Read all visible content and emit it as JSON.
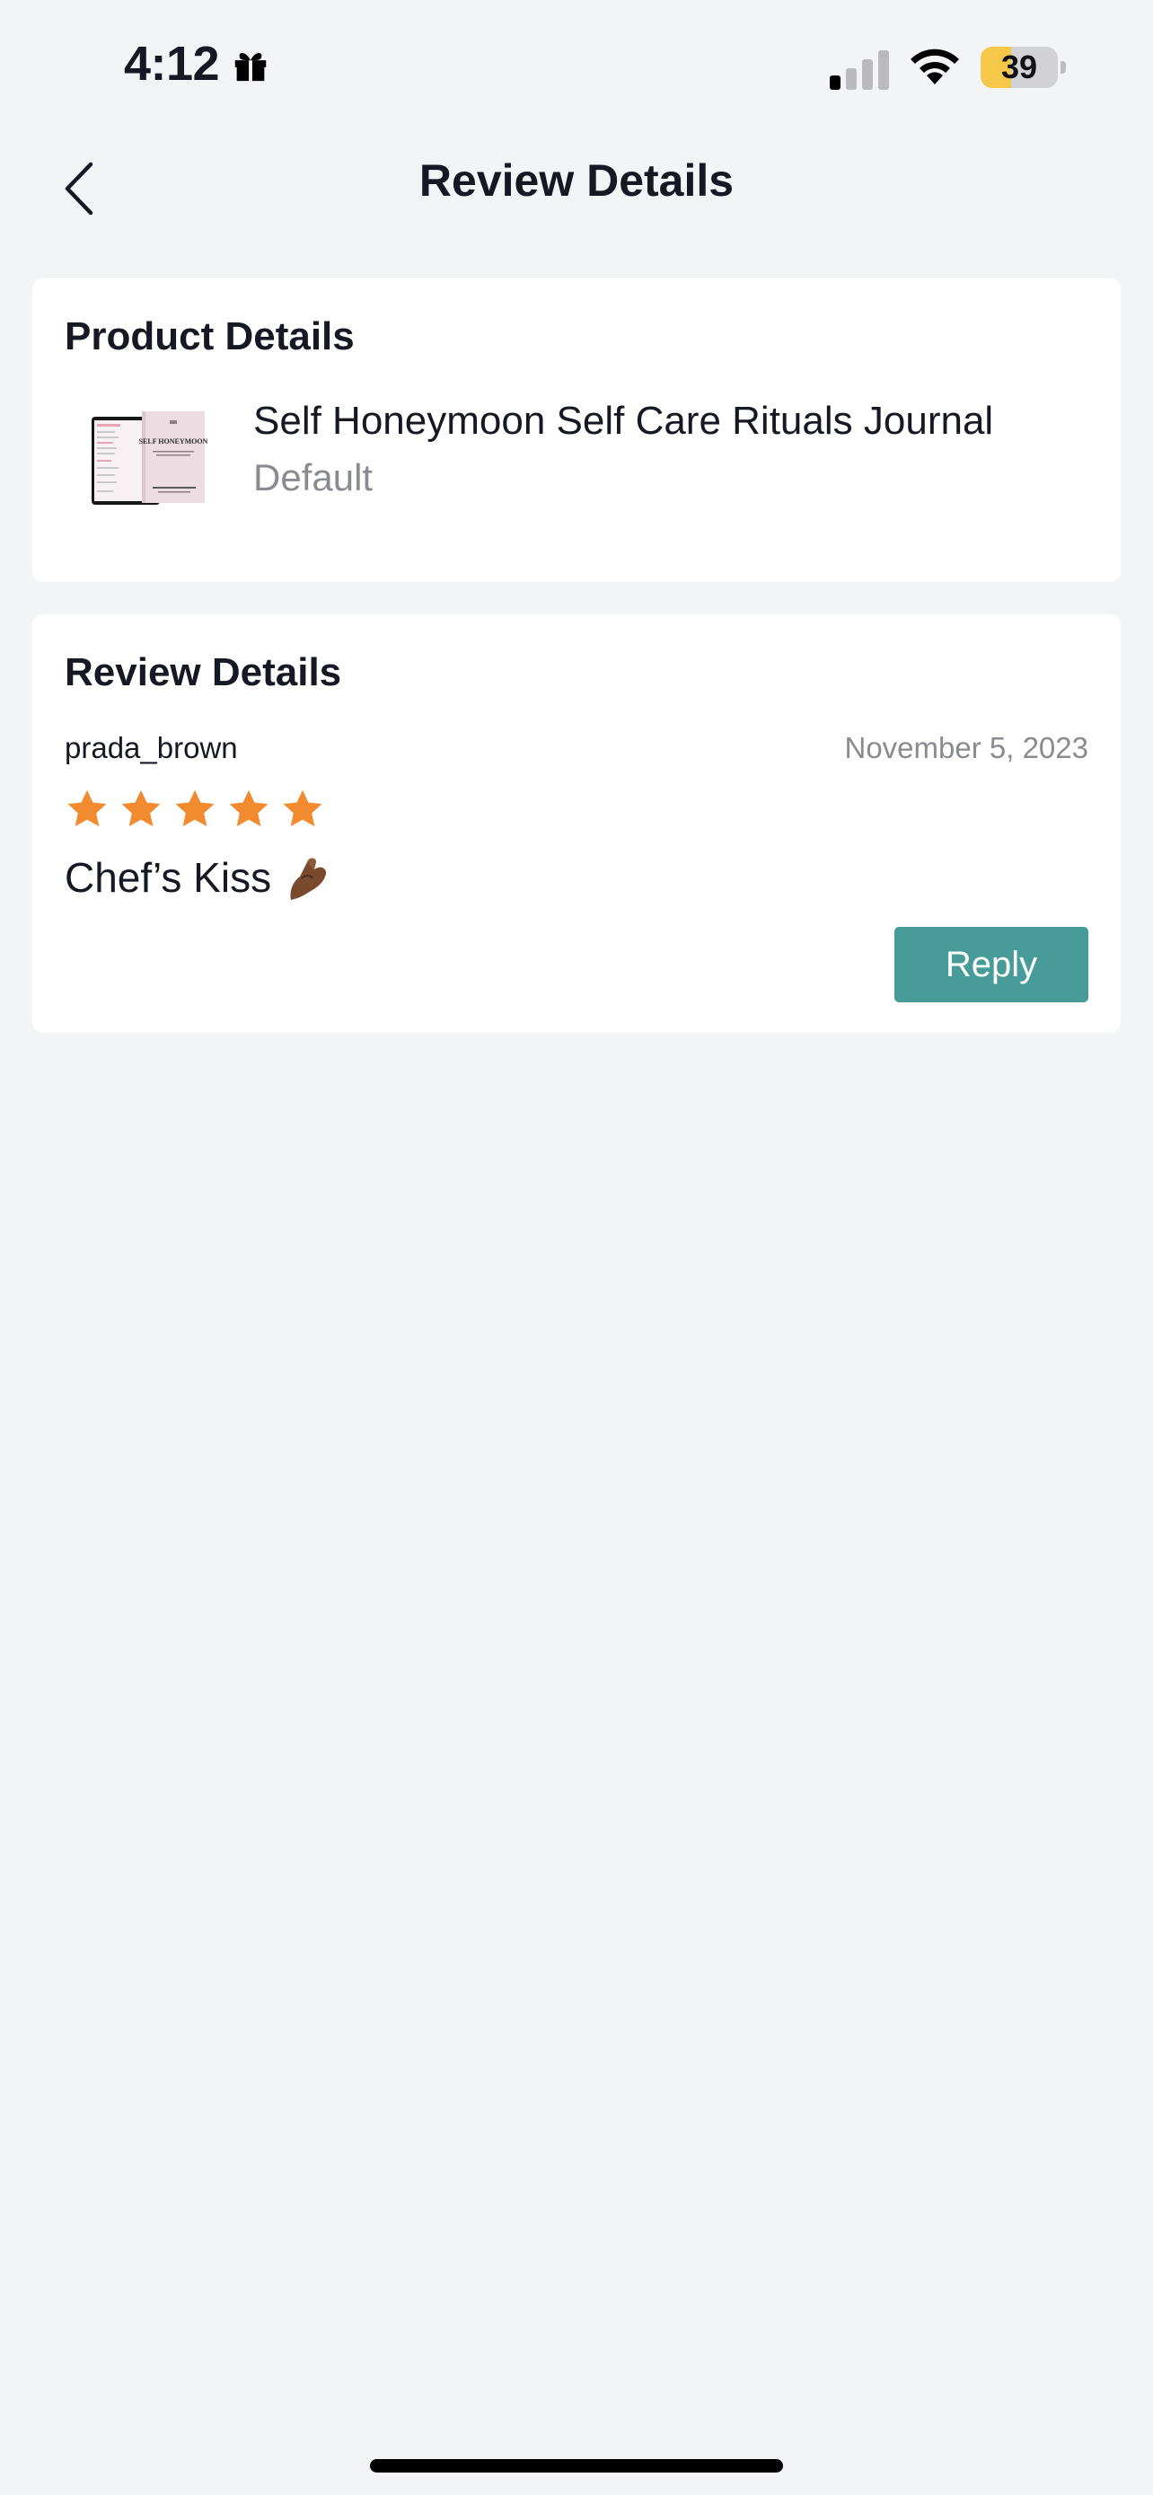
{
  "status_bar": {
    "time": "4:12",
    "battery_level": "39",
    "battery_fraction": 0.39,
    "icons": [
      "gift-icon",
      "cellular-signal-icon",
      "wifi-icon",
      "battery-icon"
    ]
  },
  "nav": {
    "title": "Review Details",
    "back_icon": "chevron-left-icon"
  },
  "product_card": {
    "title": "Product Details",
    "product": {
      "name": "Self Honeymoon Self Care Rituals Journal",
      "variant": "Default",
      "thumbnail_cover_text": "SELF HONEYMOON"
    }
  },
  "review_card": {
    "title": "Review Details",
    "reviewer": "prada_brown",
    "date": "November 5, 2023",
    "rating": 5,
    "rating_max": 5,
    "text": "Chef’s Kiss",
    "emoji_icon": "pinched-fingers-icon",
    "reply_label": "Reply"
  },
  "colors": {
    "background": "#f3f4f6",
    "card": "#ffffff",
    "star": "#f28b30",
    "reply_button": "#479c9a",
    "battery_fill": "#f5c84a",
    "muted_text": "#8a8b91"
  }
}
